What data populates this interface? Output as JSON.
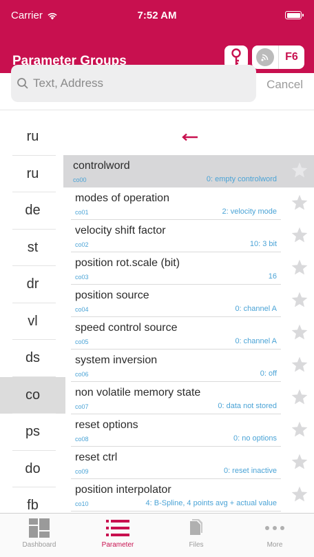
{
  "status": {
    "carrier": "Carrier",
    "time": "7:52 AM"
  },
  "header": {
    "title": "Parameter Groups",
    "device_label": "F6"
  },
  "search": {
    "placeholder": "Text, Address",
    "cancel": "Cancel"
  },
  "groups": [
    {
      "label": "ru",
      "active": false
    },
    {
      "label": "ru",
      "active": false
    },
    {
      "label": "de",
      "active": false
    },
    {
      "label": "st",
      "active": false
    },
    {
      "label": "dr",
      "active": false
    },
    {
      "label": "vl",
      "active": false
    },
    {
      "label": "ds",
      "active": false
    },
    {
      "label": "co",
      "active": true
    },
    {
      "label": "ps",
      "active": false
    },
    {
      "label": "do",
      "active": false
    },
    {
      "label": "fb",
      "active": false
    }
  ],
  "parameters": [
    {
      "name": "controlword",
      "code": "co00",
      "value": "0: empty controlword",
      "selected": true
    },
    {
      "name": "modes of operation",
      "code": "co01",
      "value": "2: velocity mode",
      "selected": false
    },
    {
      "name": "velocity shift factor",
      "code": "co02",
      "value": "10: 3 bit",
      "selected": false
    },
    {
      "name": "position rot.scale (bit)",
      "code": "co03",
      "value": "16",
      "selected": false
    },
    {
      "name": "position source",
      "code": "co04",
      "value": "0: channel A",
      "selected": false
    },
    {
      "name": "speed control source",
      "code": "co05",
      "value": "0: channel A",
      "selected": false
    },
    {
      "name": "system inversion",
      "code": "co06",
      "value": "0: off",
      "selected": false
    },
    {
      "name": "non volatile memory state",
      "code": "co07",
      "value": "0: data not stored",
      "selected": false
    },
    {
      "name": "reset options",
      "code": "co08",
      "value": "0: no options",
      "selected": false
    },
    {
      "name": "reset ctrl",
      "code": "co09",
      "value": "0: reset inactive",
      "selected": false
    },
    {
      "name": "position interpolator",
      "code": "co10",
      "value": "4: B-Spline, 4 points avg + actual value",
      "selected": false
    }
  ],
  "tabs": [
    {
      "label": "Dashboard",
      "icon": "dashboard-icon",
      "active": false
    },
    {
      "label": "Parameter",
      "icon": "list-icon",
      "active": true
    },
    {
      "label": "Files",
      "icon": "files-icon",
      "active": false
    },
    {
      "label": "More",
      "icon": "more-icon",
      "active": false
    }
  ],
  "colors": {
    "accent": "#c8104f",
    "value_blue": "#4aa3d6",
    "selected_bg": "#d7d7d9"
  }
}
